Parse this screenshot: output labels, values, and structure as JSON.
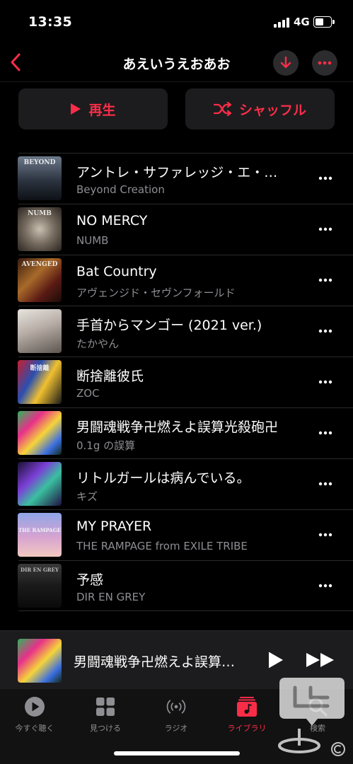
{
  "status": {
    "time": "13:35",
    "network": "4G"
  },
  "nav": {
    "title": "あえいうえおあお"
  },
  "actions": {
    "play_label": "再生",
    "shuffle_label": "シャッフル"
  },
  "colors": {
    "accent": "#fa2d48",
    "background": "#000000",
    "secondary_text": "#8e8e93"
  },
  "tracks": [
    {
      "title": "アントレ・サファレッジ・エ・…",
      "artist": "Beyond Creation",
      "art_text": "BEYOND"
    },
    {
      "title": "NO MERCY",
      "artist": "NUMB",
      "art_text": "NUMB"
    },
    {
      "title": "Bat Country",
      "artist": "アヴェンジド・セヴンフォールド",
      "art_text": "AVENGED"
    },
    {
      "title": "手首からマンゴー (2021 ver.)",
      "artist": "たかやん",
      "art_text": ""
    },
    {
      "title": "断捨離彼氏",
      "artist": "ZOC",
      "art_text": "断捨離"
    },
    {
      "title": "男闘魂戦争卍燃えよ誤算光殺砲卍",
      "artist": "0.1g の誤算",
      "art_text": ""
    },
    {
      "title": "リトルガールは病んでいる。",
      "artist": "キズ",
      "art_text": ""
    },
    {
      "title": "MY PRAYER",
      "artist": "THE RAMPAGE from EXILE TRIBE",
      "art_text": "THE RAMPAGE"
    },
    {
      "title": "予感",
      "artist": "DIR EN GREY",
      "art_text": "DIR EN GREY"
    }
  ],
  "mini_player": {
    "title": "男闘魂戦争卍燃えよ誤算…"
  },
  "tabs": [
    {
      "label": "今すぐ聴く",
      "icon": "play-circle-icon"
    },
    {
      "label": "見つける",
      "icon": "grid-icon"
    },
    {
      "label": "ラジオ",
      "icon": "radio-waves-icon"
    },
    {
      "label": "ライブラリ",
      "icon": "music-library-icon",
      "active": true
    },
    {
      "label": "検索",
      "icon": "search-icon"
    }
  ]
}
